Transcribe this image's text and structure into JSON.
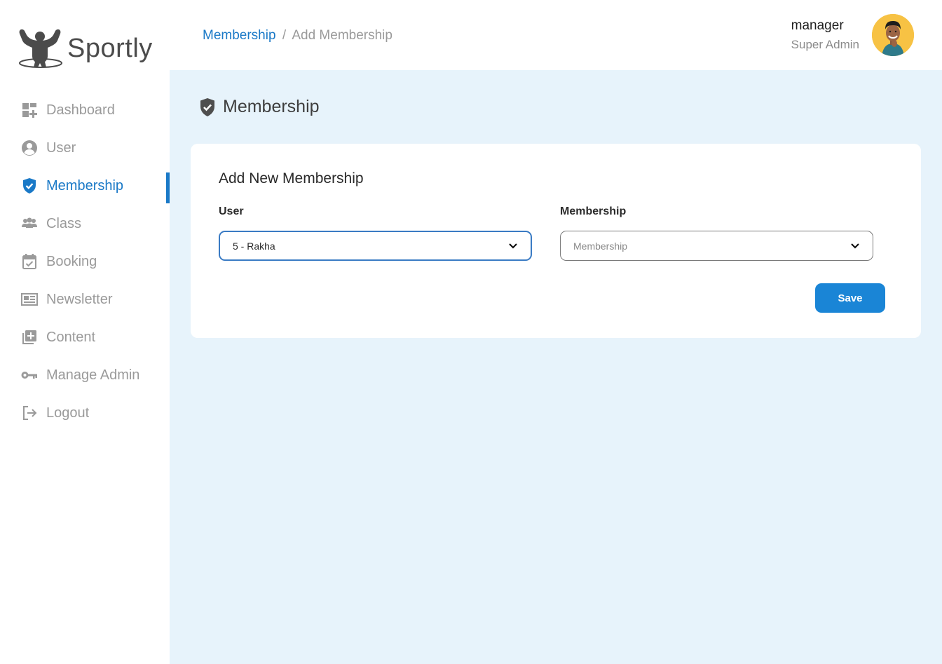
{
  "brand": {
    "name": "Sportly",
    "icon": "muscle-man-icon"
  },
  "sidebar": {
    "items": [
      {
        "label": "Dashboard",
        "icon": "dashboard-icon",
        "active": false
      },
      {
        "label": "User",
        "icon": "user-circle-icon",
        "active": false
      },
      {
        "label": "Membership",
        "icon": "shield-check-icon",
        "active": true
      },
      {
        "label": "Class",
        "icon": "group-icon",
        "active": false
      },
      {
        "label": "Booking",
        "icon": "calendar-check-icon",
        "active": false
      },
      {
        "label": "Newsletter",
        "icon": "newspaper-icon",
        "active": false
      },
      {
        "label": "Content",
        "icon": "library-add-icon",
        "active": false
      },
      {
        "label": "Manage Admin",
        "icon": "key-icon",
        "active": false
      },
      {
        "label": "Logout",
        "icon": "logout-icon",
        "active": false
      }
    ]
  },
  "header": {
    "breadcrumb": {
      "link": "Membership",
      "separator": "/",
      "current": "Add Membership"
    },
    "user": {
      "name": "manager",
      "role": "Super Admin"
    }
  },
  "main": {
    "page_title": "Membership",
    "card": {
      "title": "Add New Membership",
      "user_label": "User",
      "user_value": "5 - Rakha",
      "membership_label": "Membership",
      "membership_placeholder": "Membership",
      "save_label": "Save"
    }
  },
  "colors": {
    "accent": "#1a79c7",
    "button": "#1a85d6",
    "main_bg": "#e7f3fb",
    "avatar_bg": "#f7c244"
  }
}
